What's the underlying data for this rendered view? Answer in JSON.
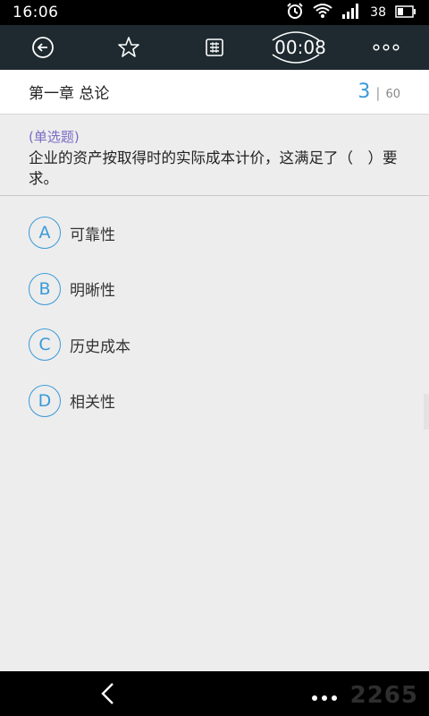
{
  "status": {
    "time": "16:06",
    "battery": "38"
  },
  "toolbar": {
    "timer": "00:08"
  },
  "chapter": {
    "title": "第一章 总论",
    "current": "3",
    "total": "60"
  },
  "question": {
    "type": "(单选题)",
    "text": "企业的资产按取得时的实际成本计价，这满足了（　）要求。"
  },
  "options": [
    {
      "letter": "A",
      "text": "可靠性"
    },
    {
      "letter": "B",
      "text": "明晰性"
    },
    {
      "letter": "C",
      "text": "历史成本"
    },
    {
      "letter": "D",
      "text": "相关性"
    }
  ],
  "watermark": "2265"
}
